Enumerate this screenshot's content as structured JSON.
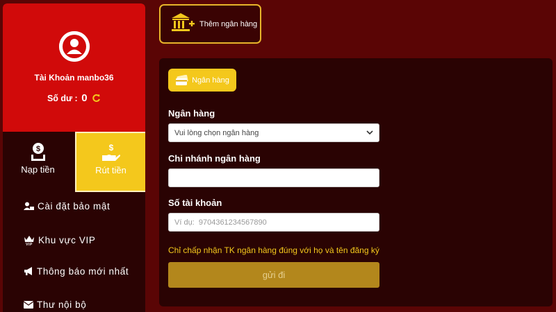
{
  "sidebar": {
    "account_label": "Tài Khoản manbo36",
    "balance_label": "Số dư :",
    "balance_value": "0",
    "deposit_label": "Nạp tiền",
    "withdraw_label": "Rút tiền",
    "menu": [
      {
        "label": "Cài đặt bảo mật",
        "icon": "user-lock-icon"
      },
      {
        "label": "Khu vực VIP",
        "icon": "vip-crown-icon"
      },
      {
        "label": "Thông báo mới nhất",
        "icon": "megaphone-icon"
      },
      {
        "label": "Thư nội bộ",
        "icon": "envelope-icon"
      }
    ]
  },
  "top": {
    "add_bank_label": "Thêm ngân hàng"
  },
  "form": {
    "tab_label": "Ngân hàng",
    "bank_label": "Ngân hàng",
    "bank_select_value": "Vui lòng chọn ngân hàng",
    "branch_label": "Chi nhánh ngân hàng",
    "branch_value": "",
    "account_no_label": "Số tài khoản",
    "account_no_placeholder": "Ví dụ:  9704361234567890",
    "note": "Chỉ chấp nhận TK ngân hàng đúng với họ và tên đăng ký",
    "submit_label": "gửi đi"
  },
  "colors": {
    "background": "#5a0505",
    "panel": "#2a0303",
    "accent_red": "#d10a0a",
    "accent_gold": "#f4c81c",
    "submit": "#b3871c"
  }
}
